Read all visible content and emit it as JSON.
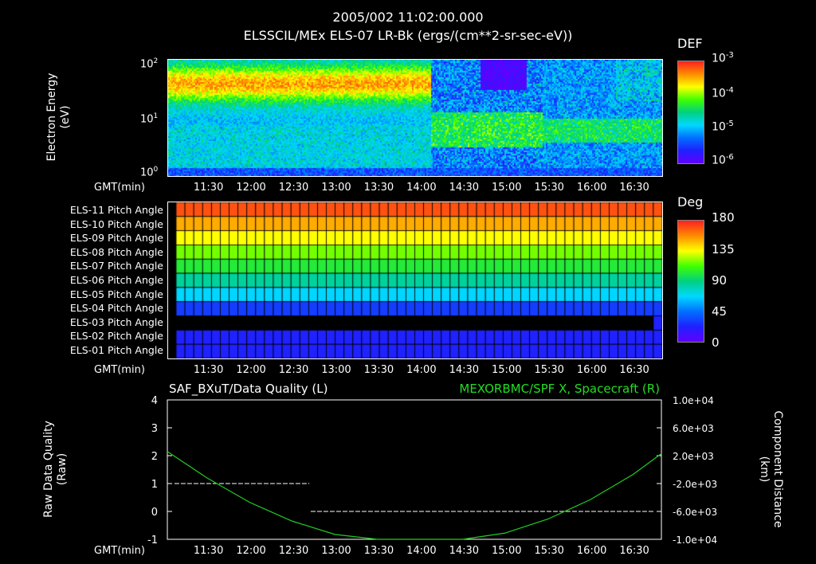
{
  "header": {
    "timestamp": "2005/002 11:02:00.000",
    "subtitle": "ELSSCIL/MEx ELS-07 LR-Bk  (ergs/(cm**2-sr-sec-eV))"
  },
  "time_ticks": [
    "11:30",
    "12:00",
    "12:30",
    "13:00",
    "13:30",
    "14:00",
    "14:30",
    "15:00",
    "15:30",
    "16:00",
    "16:30"
  ],
  "gmt_label": "GMT(min)",
  "colors": {
    "background": "#000000",
    "quality_line": "#ffffff",
    "spacecraft_line": "#22cc22",
    "right_title": "#22dd22"
  },
  "panel1": {
    "ylabel": "Electron Energy",
    "yunit": "(eV)",
    "yticks": [
      "10",
      "10",
      "10"
    ],
    "yticks_exp": [
      "2",
      "1",
      "0"
    ],
    "colorbar_label": "DEF",
    "colorbar_ticks": [
      "10",
      "10",
      "10",
      "10"
    ],
    "colorbar_exp": [
      "-3",
      "-4",
      "-5",
      "-6"
    ]
  },
  "panel2": {
    "rows": [
      "ELS-11 Pitch Angle",
      "ELS-10 Pitch Angle",
      "ELS-09 Pitch Angle",
      "ELS-08 Pitch Angle",
      "ELS-07 Pitch Angle",
      "ELS-06 Pitch Angle",
      "ELS-05 Pitch Angle",
      "ELS-04 Pitch Angle",
      "ELS-03 Pitch Angle",
      "ELS-02 Pitch Angle",
      "ELS-01 Pitch Angle"
    ],
    "colorbar_label": "Deg",
    "colorbar_ticks": [
      "180",
      "135",
      "90",
      "45",
      "0"
    ]
  },
  "panel3": {
    "left_title": "SAF_BXuT/Data Quality (L)",
    "right_title": "MEXORBMC/SPF X, Spacecraft (R)",
    "ylabel": "Raw Data Quality",
    "yunit": "(Raw)",
    "yticks": [
      "4",
      "3",
      "2",
      "1",
      "0",
      "-1"
    ],
    "rlabel": "Component Distance",
    "runit": "(km)",
    "rticks": [
      "1.0e+04",
      "6.0e+03",
      "2.0e+03",
      "-2.0e+03",
      "-6.0e+03",
      "-1.0e+04"
    ]
  },
  "chart_data": [
    {
      "type": "heatmap",
      "title": "ELSSCIL/MEx ELS-07 LR-Bk  (ergs/(cm**2-sr-sec-eV))",
      "ylabel": "Electron Energy (eV)",
      "xlabel": "GMT(min)",
      "yscale": "log",
      "ylim": [
        1,
        150
      ],
      "xlim": [
        "11:02",
        "16:50"
      ],
      "colorbar": {
        "label": "DEF",
        "scale": "log",
        "range": [
          1e-06,
          0.001
        ]
      }
    },
    {
      "type": "heatmap",
      "xlabel": "GMT(min)",
      "categories": [
        "ELS-11 Pitch Angle",
        "ELS-10 Pitch Angle",
        "ELS-09 Pitch Angle",
        "ELS-08 Pitch Angle",
        "ELS-07 Pitch Angle",
        "ELS-06 Pitch Angle",
        "ELS-05 Pitch Angle",
        "ELS-04 Pitch Angle",
        "ELS-03 Pitch Angle",
        "ELS-02 Pitch Angle",
        "ELS-01 Pitch Angle"
      ],
      "values": [
        170,
        152,
        135,
        118,
        102,
        85,
        68,
        30,
        null,
        22,
        22
      ],
      "colorbar": {
        "label": "Deg",
        "range": [
          0,
          180
        ]
      }
    },
    {
      "type": "line",
      "xlabel": "GMT(min)",
      "ylabel": "Raw Data Quality (Raw)",
      "ylim": [
        -1,
        4
      ],
      "y2label": "Component Distance (km)",
      "y2lim": [
        -10000,
        10000
      ],
      "series": [
        {
          "name": "SAF_BXuT/Data Quality (L)",
          "axis": "left",
          "x": [
            "11:07",
            "12:42",
            "12:43",
            "16:45"
          ],
          "y": [
            1,
            1,
            0,
            0
          ]
        },
        {
          "name": "MEXORBMC/SPF X, Spacecraft (R)",
          "axis": "right",
          "x": [
            "11:02",
            "11:30",
            "12:00",
            "12:30",
            "13:00",
            "13:30",
            "14:00",
            "14:30",
            "15:00",
            "15:30",
            "16:00",
            "16:30",
            "16:50"
          ],
          "y": [
            2600,
            -1200,
            -4700,
            -7400,
            -9300,
            -10400,
            -10700,
            -10300,
            -9100,
            -7100,
            -4300,
            -700,
            2300
          ]
        }
      ]
    }
  ]
}
